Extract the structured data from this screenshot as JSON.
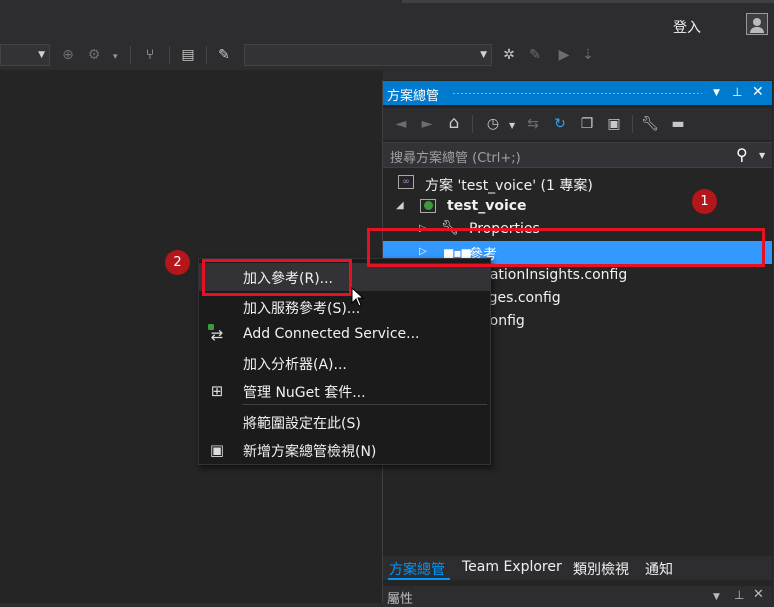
{
  "header": {
    "sign_in": "登入"
  },
  "solution_explorer": {
    "title": "方案總管",
    "search_placeholder": "搜尋方案總管 (Ctrl+;)",
    "tree": {
      "solution": "方案 'test_voice' (1 專案)",
      "project": "test_voice",
      "properties": "Properties",
      "references": "參考",
      "file1": "ApplicationInsights.config",
      "file2": "packages.config",
      "file3": "Web.config"
    },
    "tabs": [
      "方案總管",
      "Team Explorer",
      "類別檢視",
      "通知"
    ],
    "properties_title": "屬性"
  },
  "context_menu": {
    "items": [
      {
        "label": "加入參考(R)...",
        "icon": ""
      },
      {
        "label": "加入服務參考(S)...",
        "icon": ""
      },
      {
        "label": "Add Connected Service...",
        "icon": "connected-service-icon"
      },
      {
        "label": "加入分析器(A)...",
        "icon": ""
      },
      {
        "label": "管理 NuGet 套件...",
        "icon": "nuget-icon"
      },
      {
        "label": "將範圍設定在此(S)",
        "icon": ""
      },
      {
        "label": "新增方案總管檢視(N)",
        "icon": "new-view-icon"
      }
    ]
  },
  "annotations": {
    "badge1": "1",
    "badge2": "2"
  },
  "colors": {
    "accent": "#007acc",
    "selection": "#3399ff",
    "annotation_red": "#e81123",
    "background": "#2d2d30"
  }
}
